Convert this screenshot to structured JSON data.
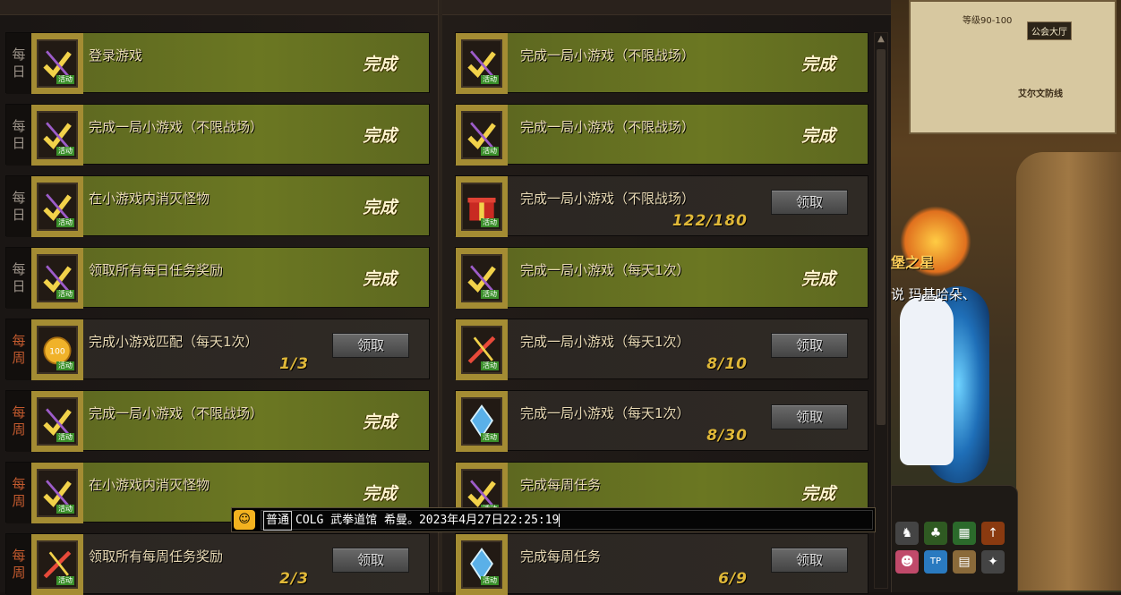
{
  "quests_left": [
    {
      "tag": [
        "每",
        "日"
      ],
      "tag_type": "daily",
      "name": "登录游戏",
      "status": "完成",
      "progress": "",
      "icon": "check-icon"
    },
    {
      "tag": [
        "每",
        "日"
      ],
      "tag_type": "daily",
      "name": "完成一局小游戏（不限战场）",
      "status": "完成",
      "progress": "",
      "icon": "check-icon"
    },
    {
      "tag": [
        "每",
        "日"
      ],
      "tag_type": "daily",
      "name": "在小游戏内消灭怪物",
      "status": "完成",
      "progress": "",
      "icon": "check-icon"
    },
    {
      "tag": [
        "每",
        "日"
      ],
      "tag_type": "daily",
      "name": "领取所有每日任务奖励",
      "status": "完成",
      "progress": "",
      "icon": "check-icon"
    },
    {
      "tag": [
        "每",
        "周"
      ],
      "tag_type": "weekly",
      "name": "完成小游戏匹配（每天1次）",
      "status": "",
      "progress": "1/3",
      "button": "领取",
      "icon": "coin-icon"
    },
    {
      "tag": [
        "每",
        "周"
      ],
      "tag_type": "weekly",
      "name": "完成一局小游戏（不限战场）",
      "status": "完成",
      "progress": "",
      "icon": "check-icon"
    },
    {
      "tag": [
        "每",
        "周"
      ],
      "tag_type": "weekly",
      "name": "在小游戏内消灭怪物",
      "status": "完成",
      "progress": "",
      "icon": "check-icon"
    },
    {
      "tag": [
        "每",
        "周"
      ],
      "tag_type": "weekly",
      "name": "领取所有每周任务奖励",
      "status": "",
      "progress": "2/3",
      "button": "领取",
      "icon": "sword-icon"
    }
  ],
  "quests_right": [
    {
      "name": "完成一局小游戏（不限战场）",
      "status": "完成",
      "progress": "",
      "icon": "check-icon"
    },
    {
      "name": "完成一局小游戏（不限战场）",
      "status": "完成",
      "progress": "",
      "icon": "check-icon"
    },
    {
      "name": "完成一局小游戏（不限战场）",
      "status": "",
      "progress": "122/180",
      "button": "领取",
      "icon": "gift-icon"
    },
    {
      "name": "完成一局小游戏（每天1次）",
      "status": "完成",
      "progress": "",
      "icon": "check-icon"
    },
    {
      "name": "完成一局小游戏（每天1次）",
      "status": "",
      "progress": "8/10",
      "button": "领取",
      "icon": "sword-icon"
    },
    {
      "name": "完成一局小游戏（每天1次）",
      "status": "",
      "progress": "8/30",
      "button": "领取",
      "icon": "crystal-icon"
    },
    {
      "name": "完成每周任务",
      "status": "完成",
      "progress": "",
      "icon": "check-icon"
    },
    {
      "name": "完成每周任务",
      "status": "",
      "progress": "6/9",
      "button": "领取",
      "icon": "crystal-icon"
    }
  ],
  "icon_badge": "活动",
  "map": {
    "level_text": "等级90-100",
    "guild_label": "公会大厅",
    "area_name": "艾尔文防线"
  },
  "npc": {
    "title": "堡之星",
    "name": "说 玛基哈朵、"
  },
  "chat": {
    "channel": "普通",
    "text": "COLG 武拳道馆 希曼。2023年4月27日22:25:19"
  },
  "hud_icons": [
    "character-icon",
    "sprout-icon",
    "calendar-icon",
    "upgrade-icon",
    "avatar-icon",
    "tp-icon",
    "book-icon",
    "wand-icon"
  ]
}
